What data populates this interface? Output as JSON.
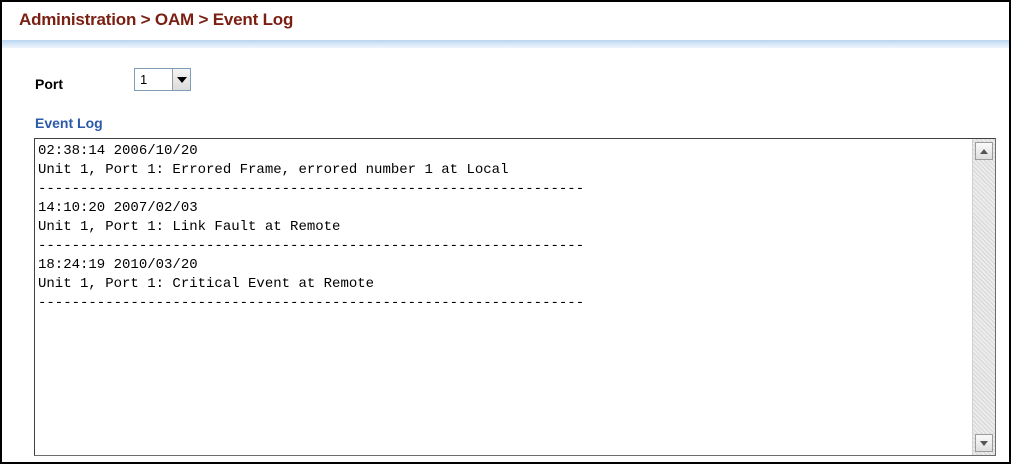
{
  "header": {
    "breadcrumb": "Administration > OAM > Event Log"
  },
  "port": {
    "label": "Port",
    "selected": "1"
  },
  "event_log": {
    "label": "Event Log",
    "content": "02:38:14 2006/10/20\nUnit 1, Port 1: Errored Frame, errored number 1 at Local\n-----------------------------------------------------------------\n14:10:20 2007/02/03\nUnit 1, Port 1: Link Fault at Remote\n-----------------------------------------------------------------\n18:24:19 2010/03/20\nUnit 1, Port 1: Critical Event at Remote\n-----------------------------------------------------------------"
  },
  "colors": {
    "title": "#7a1f12",
    "section_label": "#2a5ba8",
    "title_rule": "#b9d5f0"
  },
  "icons": {
    "dropdown": "chevron-down-icon",
    "scroll_up": "arrow-up-icon",
    "scroll_down": "arrow-down-icon"
  }
}
